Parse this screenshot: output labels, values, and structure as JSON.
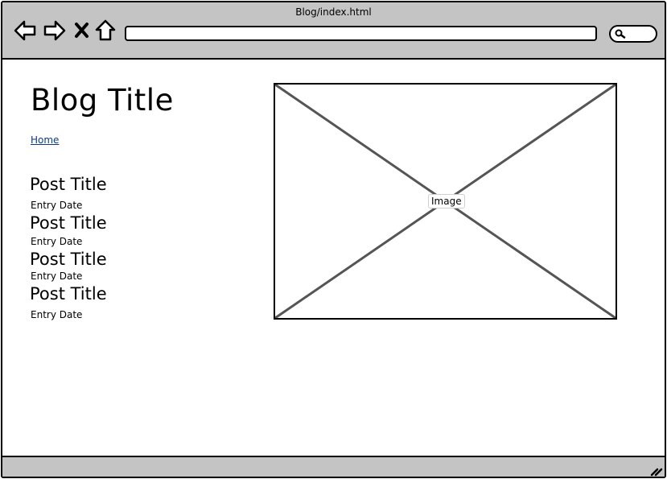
{
  "window": {
    "title": "Blog/index.html"
  },
  "toolbar": {
    "back_icon": "back-arrow-icon",
    "forward_icon": "forward-arrow-icon",
    "stop_icon": "close-icon",
    "home_icon": "home-icon",
    "url_value": "",
    "search_icon": "search-icon",
    "color": "#c4c4c4"
  },
  "page": {
    "blog_title": "Blog Title",
    "home_link": "Home",
    "link_color": "#0b3a8a",
    "posts": [
      {
        "title": "Post Title",
        "date": "Entry Date"
      },
      {
        "title": "Post Title",
        "date": "Entry Date"
      },
      {
        "title": "Post Title",
        "date": "Entry Date"
      },
      {
        "title": "Post Title",
        "date": "Entry Date"
      }
    ],
    "image": {
      "label": "Image"
    }
  },
  "statusbar": {
    "grip_icon": "resize-grip-icon"
  }
}
